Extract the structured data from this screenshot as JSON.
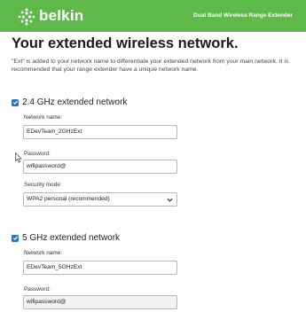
{
  "header": {
    "brand": "belkin",
    "product": "Dual Band Wireless Range Extender",
    "colors": {
      "brand_green": "#5fb94a",
      "text": "#ffffff"
    }
  },
  "main": {
    "title": "Your extended wireless network.",
    "intro": "\"Ext\" is added to your network name to differentiate your extended network from your main network. It is recommended that your range extender have a unique network name."
  },
  "band_24": {
    "checked": true,
    "title": "2.4 GHz extended network",
    "network_name_label": "Network name:",
    "network_name_value": "EDevTeam_2GHzExt",
    "password_label": "Password:",
    "password_value": "wifipassword@",
    "security_label": "Security mode:",
    "security_value": "WPA2 personal (recommended)"
  },
  "band_5": {
    "checked": true,
    "title": "5 GHz extended network",
    "network_name_label": "Network name:",
    "network_name_value": "EDevTeam_5GHzExt",
    "password_label": "Password:",
    "password_value": "wifipassword@"
  },
  "icons": {
    "logo": "belkin-dots-logo-icon",
    "checkbox": "checkmark-icon",
    "select": "chevron-down-icon",
    "cursor": "mouse-pointer-icon"
  },
  "colors": {
    "checkbox_blue": "#2a6fd6"
  }
}
